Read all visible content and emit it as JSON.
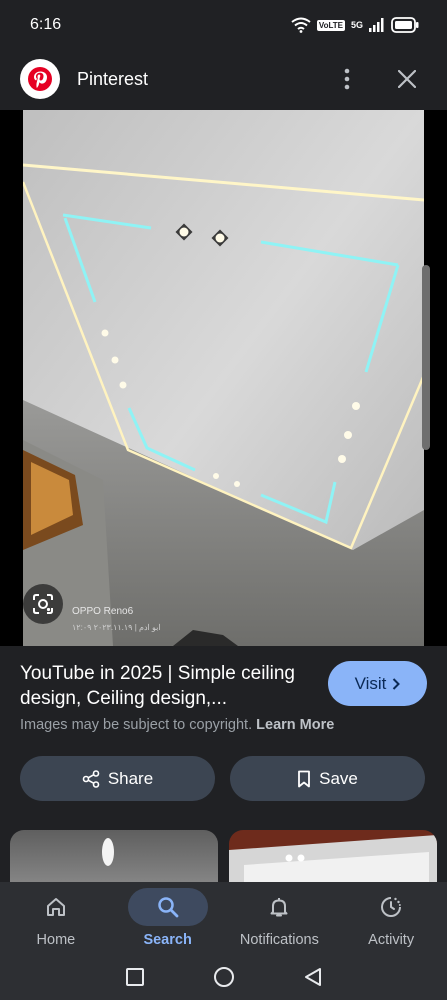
{
  "status_bar": {
    "time": "6:16",
    "volte_label": "VoLTE",
    "network_label": "5G",
    "icons": [
      "wifi-icon",
      "signal-icon",
      "battery-icon"
    ]
  },
  "header": {
    "title": "Pinterest",
    "icons": [
      "pinterest-logo",
      "more-vert-icon",
      "close-icon"
    ]
  },
  "image": {
    "watermark": "OPPO Reno6",
    "watermark_sub": "ابو ادم | ٢٠٢٣.١١.١٩ ١٢:٠٩",
    "lens_icon": "lens-icon"
  },
  "result": {
    "title": "YouTube in 2025 | Simple ceiling design, Ceiling design,...",
    "visit_label": "Visit",
    "copyright_text": "Images may be subject to copyright.",
    "learn_more_label": "Learn More",
    "share_label": "Share",
    "save_label": "Save"
  },
  "bottom_nav": {
    "items": [
      {
        "label": "Home",
        "icon": "home-icon",
        "active": false
      },
      {
        "label": "Search",
        "icon": "search-icon",
        "active": true
      },
      {
        "label": "Notifications",
        "icon": "bell-icon",
        "active": false
      },
      {
        "label": "Activity",
        "icon": "activity-icon",
        "active": false
      }
    ]
  },
  "system_nav": {
    "icons": [
      "recents-icon",
      "home-circle-icon",
      "back-icon"
    ]
  },
  "colors": {
    "background": "#202124",
    "accent": "#8ab4f8",
    "button": "#3c4552",
    "nav_bg": "#2d2f33"
  }
}
